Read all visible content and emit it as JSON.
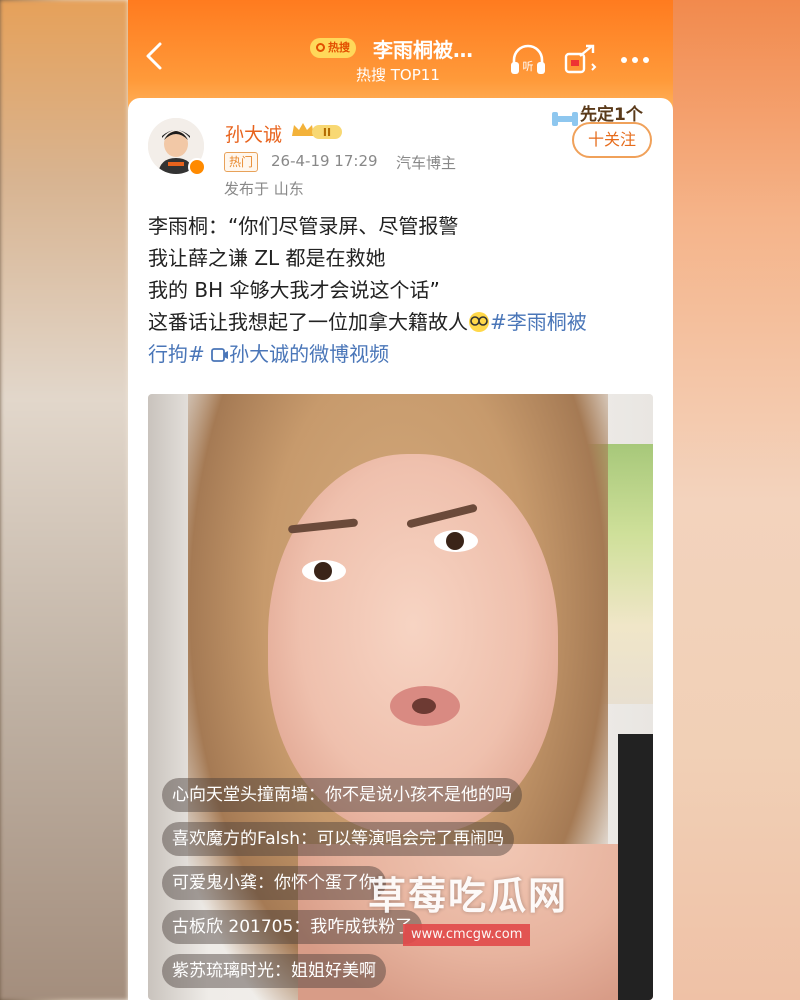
{
  "header": {
    "back_label": "<",
    "hot_badge": "热搜",
    "title": "李雨桐被…",
    "subtitle": "热搜 TOP11",
    "listen_label": "听"
  },
  "post": {
    "author": "孙大诚",
    "vip_level": "II",
    "hot_tag": "热门",
    "time": "26-4-19 17:29",
    "category": "汽车博主",
    "location": "发布于 山东",
    "follow_label": "十关注",
    "sticker_text": "先定1个",
    "lines": [
      "李雨桐：“你们尽管录屏、尽管报警",
      "我让薛之谦 ZL 都是在救她",
      "我的 BH 伞够大我才会说这个话”",
      "这番话让我想起了一位加拿大籍故人"
    ],
    "hashtag_part1": "#李雨桐被",
    "hashtag_part2": "行拘#",
    "video_link": "孙大诚的微博视频"
  },
  "video": {
    "comments": [
      "心向天堂头撞南墙：你不是说小孩不是他的吗",
      "喜欢魔方的Falsh：可以等演唱会完了再闹吗",
      "可爱鬼小龚：你怀个蛋了你",
      "古板欣 201705：我咋成铁粉了",
      "紫苏琉璃时光：姐姐好美啊"
    ],
    "watermark": "草莓吃瓜网",
    "watermark_url": "www.cmcgw.com"
  },
  "colors": {
    "accent_orange": "#ff7b1f",
    "username": "#e8631d",
    "hashtag": "#4a76b8"
  }
}
